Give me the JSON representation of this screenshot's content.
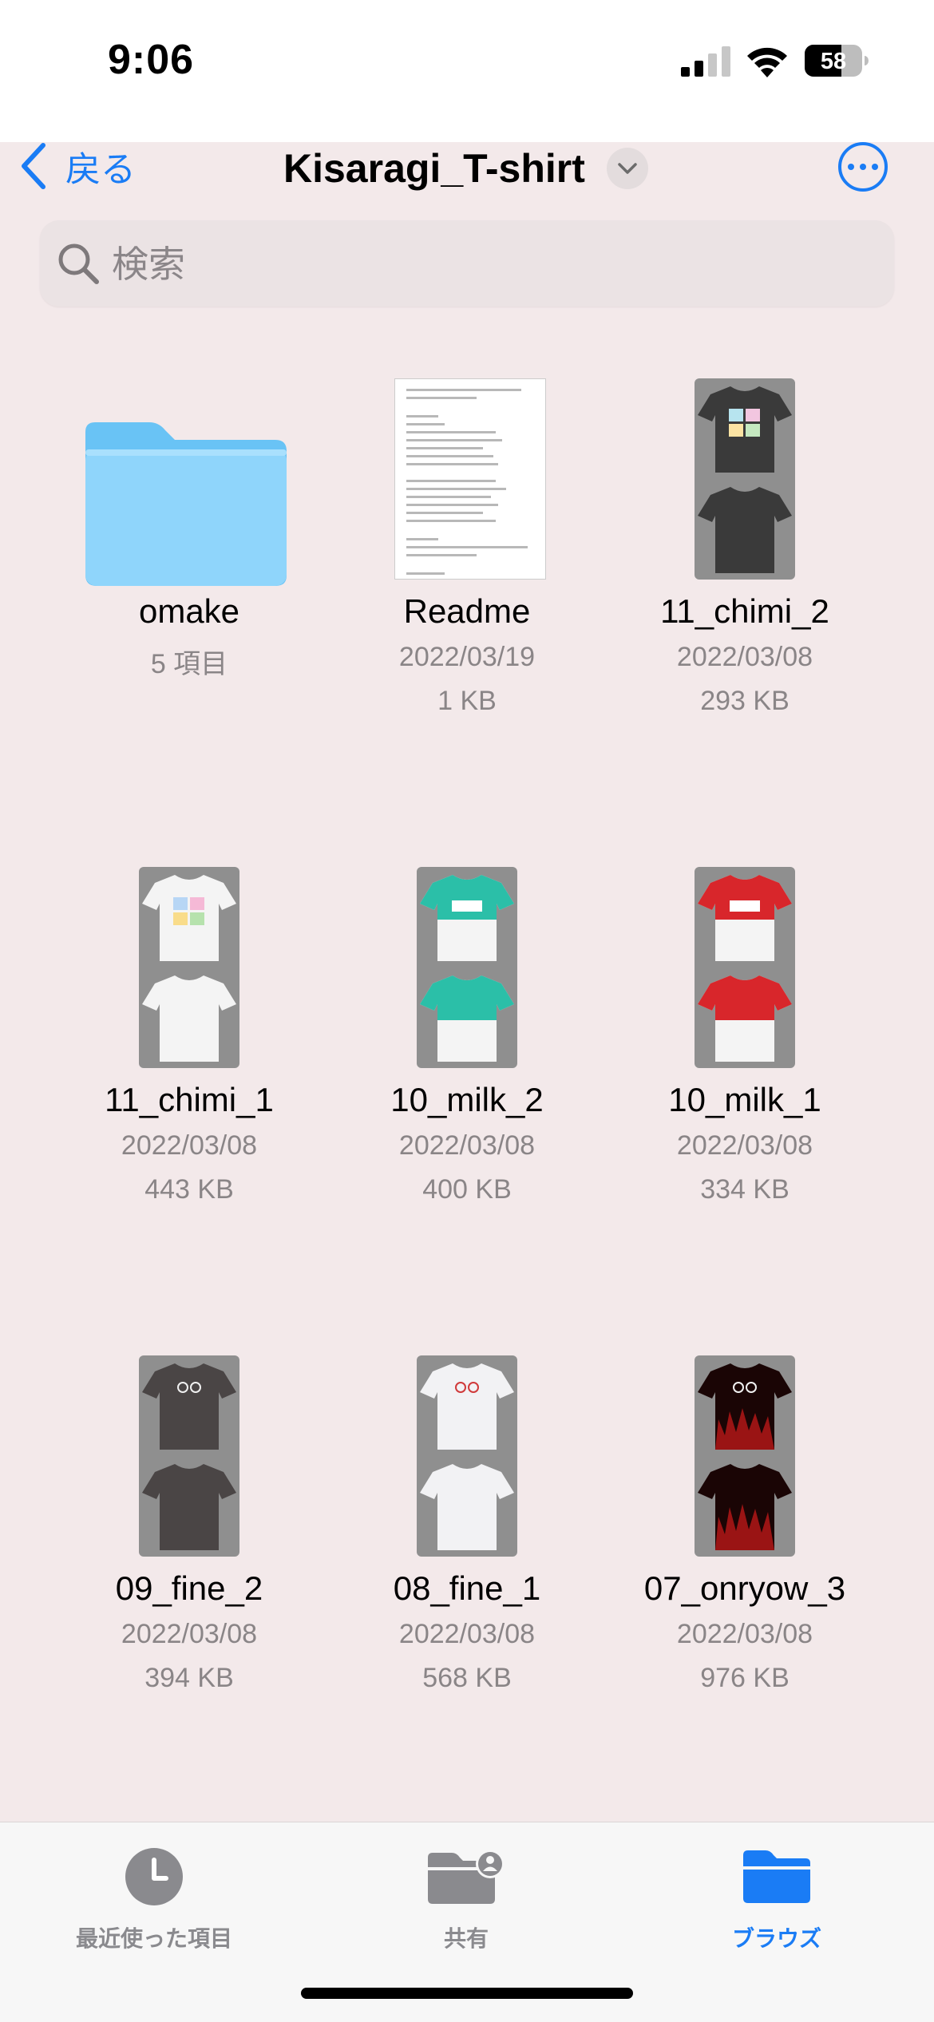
{
  "status_bar": {
    "time": "9:06",
    "battery": "58"
  },
  "nav": {
    "back_label": "戻る",
    "title": "Kisaragi_T-shirt"
  },
  "search": {
    "placeholder": "検索"
  },
  "files": [
    {
      "name": "omake",
      "line1": "5 項目",
      "line2": "",
      "kind": "folder"
    },
    {
      "name": "Readme",
      "line1": "2022/03/19",
      "line2": "1 KB",
      "kind": "document"
    },
    {
      "name": "11_chimi_2",
      "line1": "2022/03/08",
      "line2": "293 KB",
      "kind": "image",
      "shirt_color": "#3a3a3a"
    },
    {
      "name": "11_chimi_1",
      "line1": "2022/03/08",
      "line2": "443 KB",
      "kind": "image",
      "shirt_color": "#f4f4f4"
    },
    {
      "name": "10_milk_2",
      "line1": "2022/03/08",
      "line2": "400 KB",
      "kind": "image",
      "shirt_color": "#2bbfa8"
    },
    {
      "name": "10_milk_1",
      "line1": "2022/03/08",
      "line2": "334 KB",
      "kind": "image",
      "shirt_color": "#d8262b"
    },
    {
      "name": "09_fine_2",
      "line1": "2022/03/08",
      "line2": "394 KB",
      "kind": "image",
      "shirt_color": "#4a4545"
    },
    {
      "name": "08_fine_1",
      "line1": "2022/03/08",
      "line2": "568 KB",
      "kind": "image",
      "shirt_color": "#f2f2f4"
    },
    {
      "name": "07_onryow_3",
      "line1": "2022/03/08",
      "line2": "976 KB",
      "kind": "image",
      "shirt_color": "#7a1010"
    }
  ],
  "tabbar": {
    "recents_label": "最近使った項目",
    "shared_label": "共有",
    "browse_label": "ブラウズ"
  },
  "colors": {
    "accent": "#1a7cf5",
    "background": "#f3e9ea",
    "folder": "#7fcdf8"
  },
  "icons": [
    "chevron-left-icon",
    "chevron-down-icon",
    "ellipsis-circle-icon",
    "search-icon",
    "clock-icon",
    "shared-folder-icon",
    "folder-icon"
  ]
}
